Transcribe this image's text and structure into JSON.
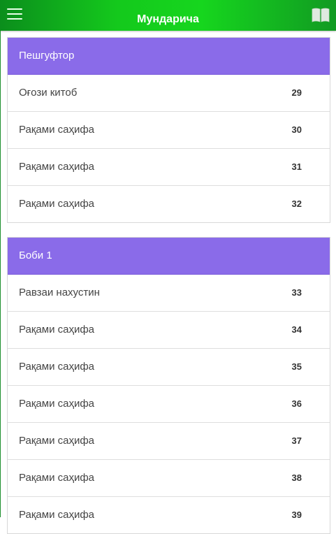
{
  "header": {
    "title": "Мундарича",
    "menu_icon": "hamburger-menu-icon",
    "book_icon": "open-book-icon",
    "bar_color": "#14c91c"
  },
  "sections": [
    {
      "title": "Пешгуфтор",
      "header_color": "#8a6be9",
      "items": [
        {
          "label": "Оғози китоб",
          "page": "29"
        },
        {
          "label": "Рақами саҳифа",
          "page": "30"
        },
        {
          "label": "Рақами саҳифа",
          "page": "31"
        },
        {
          "label": "Рақами саҳифа",
          "page": "32"
        }
      ]
    },
    {
      "title": "Боби 1",
      "header_color": "#8a6be9",
      "items": [
        {
          "label": "Равзаи нахустин",
          "page": "33"
        },
        {
          "label": "Рақами саҳифа",
          "page": "34"
        },
        {
          "label": "Рақами саҳифа",
          "page": "35"
        },
        {
          "label": "Рақами саҳифа",
          "page": "36"
        },
        {
          "label": "Рақами саҳифа",
          "page": "37"
        },
        {
          "label": "Рақами саҳифа",
          "page": "38"
        },
        {
          "label": "Рақами саҳифа",
          "page": "39"
        }
      ]
    }
  ]
}
